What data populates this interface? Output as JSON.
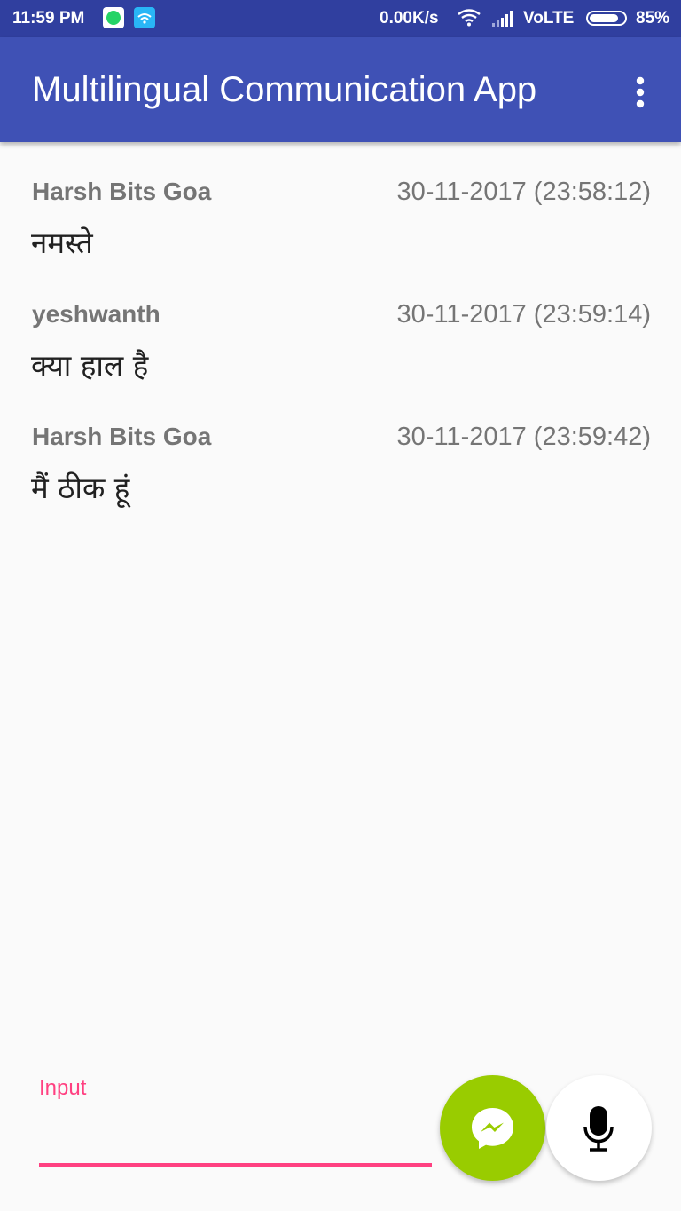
{
  "status_bar": {
    "time": "11:59 PM",
    "network_speed": "0.00K/s",
    "network_type": "VoLTE",
    "battery_percent": "85%",
    "battery_level": 0.85,
    "icons": [
      "whatsapp-icon",
      "wifi-app-icon",
      "wifi-icon",
      "signal-icon",
      "battery-icon"
    ]
  },
  "app_bar": {
    "title": "Multilingual Communication App",
    "overflow_icon": "more-vert-icon",
    "color": "#3f51b5"
  },
  "messages": [
    {
      "sender": "Harsh Bits Goa",
      "timestamp": "30-11-2017 (23:58:12)",
      "text": "नमस्ते"
    },
    {
      "sender": "yeshwanth",
      "timestamp": "30-11-2017 (23:59:14)",
      "text": "क्या हाल है"
    },
    {
      "sender": "Harsh Bits Goa",
      "timestamp": "30-11-2017 (23:59:42)",
      "text": "मैं ठीक हूं"
    }
  ],
  "input": {
    "label": "Input",
    "value": "",
    "accent_color": "#ff4081"
  },
  "actions": {
    "send_icon": "messenger-icon",
    "send_color": "#99cc00",
    "mic_icon": "microphone-icon"
  }
}
